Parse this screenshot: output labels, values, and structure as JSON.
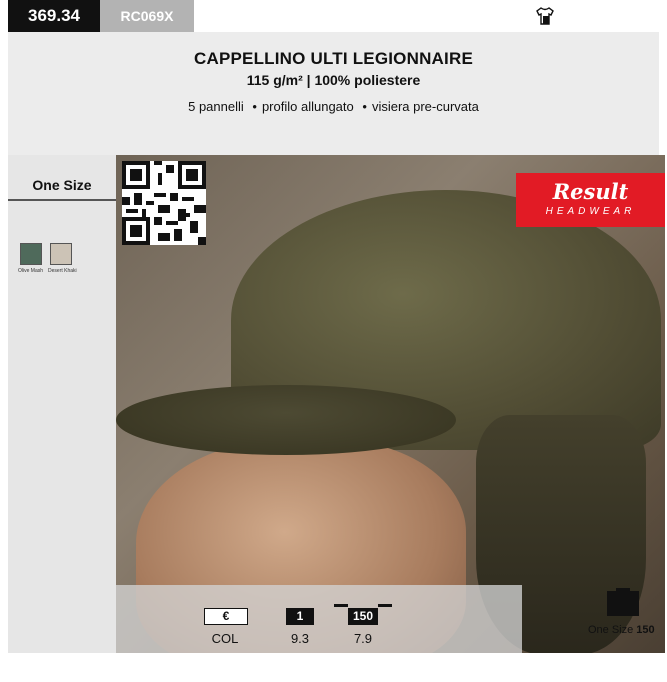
{
  "top_bar": {
    "page_code": "369.34",
    "product_code": "RC069X"
  },
  "product": {
    "title": "CAPPELLINO ULTI LEGIONNAIRE",
    "subtitle": "115 g/m² | 100% poliestere",
    "features": [
      "5 pannelli",
      "profilo allungato",
      "visiera pre-curvata"
    ]
  },
  "sidebar": {
    "size_label": "One Size",
    "colors": [
      {
        "name": "Olive Mash",
        "hex": "#4f6a5b"
      },
      {
        "name": "Desert Khaki",
        "hex": "#ccc3b6"
      }
    ]
  },
  "brand": {
    "name": "Result",
    "sub": "HEADWEAR",
    "color": "#e21b25"
  },
  "pricing": {
    "euro_label": "€",
    "qty1_label": "1",
    "qty150_label": "150",
    "col_label": "COL",
    "price_1": "9.3",
    "price_150": "7.9"
  },
  "packaging": {
    "size_label": "One Size",
    "quantity": "150"
  },
  "icons": {
    "garment": "tshirt-icon",
    "box": "box-icon",
    "qr": "qr-code"
  }
}
